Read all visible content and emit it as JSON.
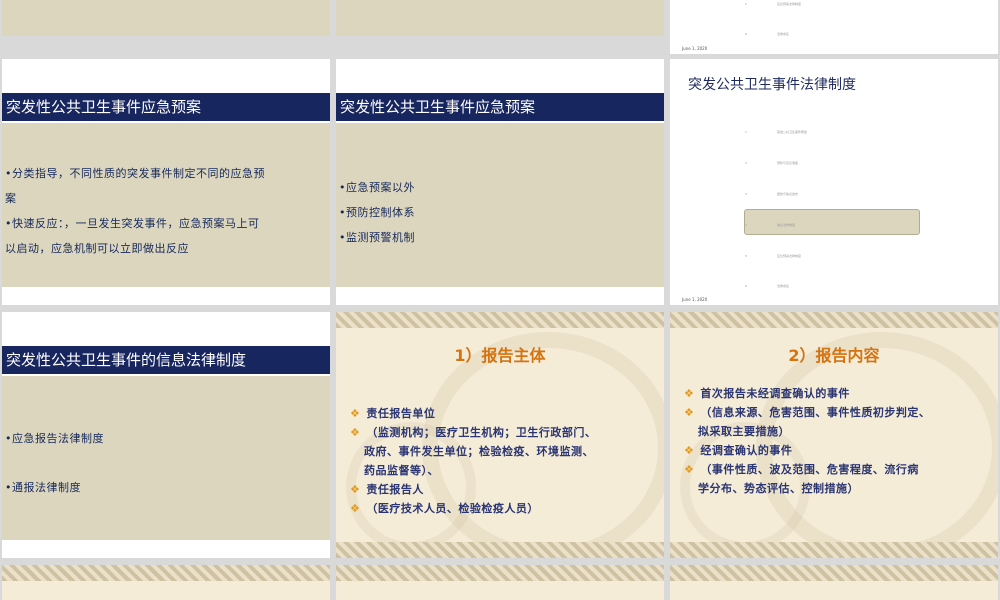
{
  "slides": {
    "r1c3": {
      "date": "June 1, 2020",
      "items": [
        {
          "num": "5",
          "label": "应急预案法律制度"
        },
        {
          "num": "6",
          "label": "法律责任"
        }
      ]
    },
    "r2c1": {
      "title": "突发性公共卫生事件应急预案",
      "lines": [
        "•分类指导，不同性质的突发事件制定不同的应急预",
        "案",
        "•快速反应：，一旦发生突发事件，应急预案马上可",
        "以启动，应急机制可以立即做出反应"
      ]
    },
    "r2c2": {
      "title": "突发性公共卫生事件应急预案",
      "lines": [
        "•应急预案以外",
        "•预防控制体系",
        "•监测预警机制"
      ]
    },
    "r2c3": {
      "title": "突发公共卫生事件法律制度",
      "date": "June 1, 2020",
      "items": [
        {
          "num": "1",
          "label": "突发公共卫生事件概述"
        },
        {
          "num": "2",
          "label": "预防与应急准备"
        },
        {
          "num": "3",
          "label": "报告与信息发布"
        },
        {
          "num": "4",
          "label": "信息法律制度"
        },
        {
          "num": "5",
          "label": "应急预案法律制度"
        },
        {
          "num": "6",
          "label": "法律责任"
        }
      ]
    },
    "r3c1": {
      "title": "突发性公共卫生事件的信息法律制度",
      "lines": [
        "•应急报告法律制度",
        "•通报法律制度"
      ]
    },
    "r3c2": {
      "title": "1）报告主体",
      "lines": [
        {
          "bullet": true,
          "text": "责任报告单位"
        },
        {
          "bullet": true,
          "text": "（监测机构；医疗卫生机构；卫生行政部门、"
        },
        {
          "bullet": false,
          "text": "政府、事件发生单位；检验检疫、环境监测、"
        },
        {
          "bullet": false,
          "text": "药品监督等）、"
        },
        {
          "bullet": true,
          "text": "责任报告人"
        },
        {
          "bullet": true,
          "text": "（医疗技术人员、检验检疫人员）"
        }
      ]
    },
    "r3c3": {
      "title": "2）报告内容",
      "lines": [
        {
          "bullet": true,
          "text": "首次报告未经调查确认的事件"
        },
        {
          "bullet": true,
          "text": "（信息来源、危害范围、事件性质初步判定、"
        },
        {
          "bullet": false,
          "text": "拟采取主要措施）"
        },
        {
          "bullet": true,
          "text": "经调查确认的事件"
        },
        {
          "bullet": true,
          "text": "（事件性质、波及范围、危害程度、流行病"
        },
        {
          "bullet": false,
          "text": "学分布、势态评估、控制措施）"
        }
      ]
    }
  },
  "bullet_glyph": "❖",
  "colors": {
    "title_bar": "#182660",
    "beige": "#ddd6bf",
    "orange_title": "#d4730f",
    "navy_text": "#2a3572"
  }
}
